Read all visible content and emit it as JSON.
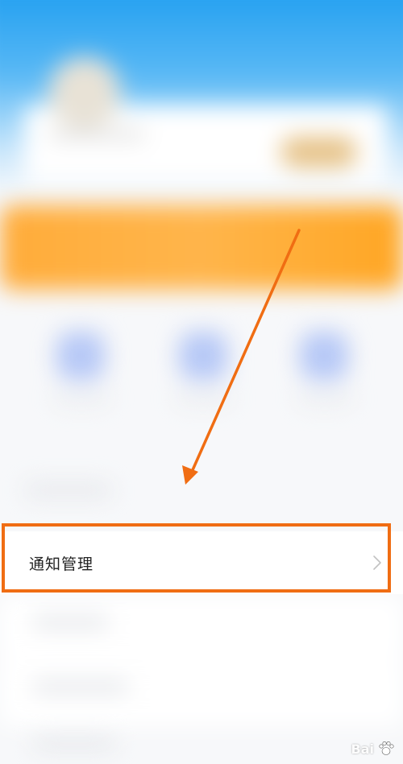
{
  "settings": {
    "notification_row": {
      "label": "通知管理",
      "chevron": "chevron-right-icon"
    }
  },
  "annotation": {
    "highlight_color": "#f06d13",
    "arrow_color": "#f06d13"
  },
  "watermark": {
    "text": "Bai",
    "icon": "baidu-paw-icon"
  }
}
